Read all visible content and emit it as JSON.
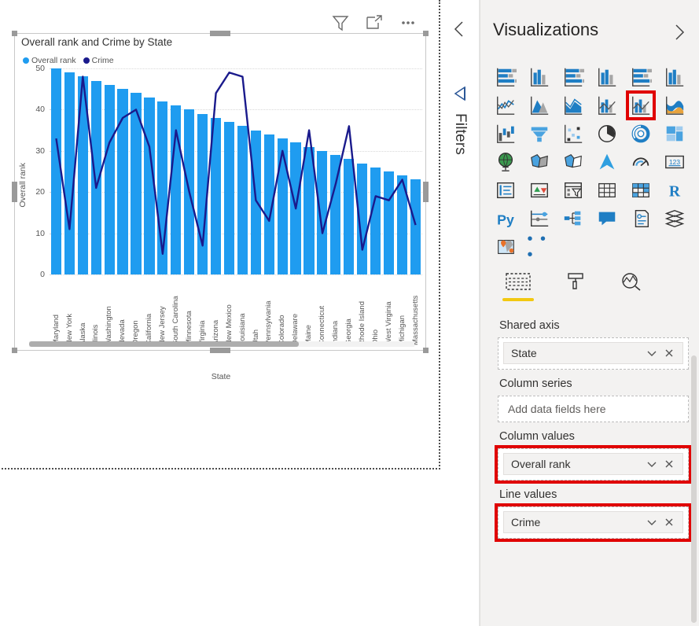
{
  "canvas": {
    "toolbar": [
      {
        "name": "filter-icon",
        "label": "Filters"
      },
      {
        "name": "focus-mode-icon",
        "label": "Focus mode"
      },
      {
        "name": "more-options-icon",
        "label": "More options"
      }
    ]
  },
  "visual": {
    "title": "Overall rank and Crime by State",
    "legend": [
      {
        "label": "Overall rank",
        "color": "#1f9cf0"
      },
      {
        "label": "Crime",
        "color": "#1a1a8c"
      }
    ],
    "x_axis_title": "State",
    "y_axis_title": "Overall rank",
    "y_ticks": [
      "0",
      "10",
      "20",
      "30",
      "40",
      "50"
    ]
  },
  "chart_data": {
    "type": "bar",
    "title": "Overall rank and Crime by State",
    "xlabel": "State",
    "ylabel": "Overall rank",
    "ylim": [
      0,
      50
    ],
    "grid": true,
    "legend_position": "top-left",
    "categories": [
      "Maryland",
      "New York",
      "Alaska",
      "Illinois",
      "Washington",
      "Nevada",
      "Oregon",
      "California",
      "New Jersey",
      "South Carolina",
      "Minnesota",
      "Virginia",
      "Arizona",
      "New Mexico",
      "Louisiana",
      "Utah",
      "Pennsylvania",
      "Colorado",
      "Delaware",
      "Maine",
      "Connecticut",
      "Indiana",
      "Georgia",
      "Rhode Island",
      "Ohio",
      "West Virginia",
      "Michigan",
      "Massachusetts"
    ],
    "series": [
      {
        "name": "Overall rank",
        "type": "column",
        "color": "#1f9cf0",
        "values": [
          50,
          49,
          48,
          47,
          46,
          45,
          44,
          43,
          42,
          41,
          40,
          39,
          38,
          37,
          36,
          35,
          34,
          33,
          32,
          31,
          30,
          29,
          28,
          27,
          26,
          25,
          24,
          23
        ]
      },
      {
        "name": "Crime",
        "type": "line",
        "color": "#1a1a8c",
        "values": [
          33,
          11,
          48,
          21,
          32,
          38,
          40,
          31,
          5,
          35,
          20,
          7,
          44,
          49,
          48,
          18,
          13,
          30,
          16,
          35,
          10,
          22,
          36,
          6,
          19,
          18,
          23,
          12
        ]
      }
    ]
  },
  "filters_pane": {
    "label": "Filters",
    "collapse_icon": "chevron-left-icon",
    "expand_icon": "filter-expand-icon"
  },
  "visualizations": {
    "title": "Visualizations",
    "expand_icon": "chevron-right-icon",
    "icons": [
      "stacked-bar-chart-icon",
      "stacked-column-chart-icon",
      "clustered-bar-chart-icon",
      "clustered-column-chart-icon",
      "100-stacked-bar-chart-icon",
      "100-stacked-column-chart-icon",
      "line-chart-icon",
      "area-chart-icon",
      "stacked-area-chart-icon",
      "line-and-stacked-column-chart-icon",
      "line-and-clustered-column-chart-icon",
      "ribbon-chart-icon",
      "waterfall-chart-icon",
      "funnel-chart-icon",
      "scatter-chart-icon",
      "pie-chart-icon",
      "donut-chart-icon",
      "treemap-icon",
      "map-icon",
      "filled-map-icon",
      "shape-map-icon",
      "arcgis-map-icon",
      "gauge-icon",
      "card-icon",
      "multi-row-card-icon",
      "kpi-icon",
      "slicer-icon",
      "table-icon",
      "matrix-icon",
      "r-script-visual-icon",
      "python-visual-icon",
      "key-influencers-icon",
      "decomposition-tree-icon",
      "q-and-a-icon",
      "smart-narrative-icon",
      "paginated-report-icon",
      "power-apps-icon"
    ],
    "selected_icon": "line-and-clustered-column-chart-icon",
    "more_icons_label": "• • •",
    "tabs": [
      {
        "name": "fields-tab",
        "icon": "fields-icon",
        "active": true
      },
      {
        "name": "format-tab",
        "icon": "paint-roller-icon",
        "active": false
      },
      {
        "name": "analytics-tab",
        "icon": "analytics-magnifier-icon",
        "active": false
      }
    ],
    "wells": [
      {
        "label": "Shared axis",
        "field": "State",
        "highlighted": false,
        "placeholder": null
      },
      {
        "label": "Column series",
        "field": null,
        "highlighted": false,
        "placeholder": "Add data fields here"
      },
      {
        "label": "Column values",
        "field": "Overall rank",
        "highlighted": true,
        "placeholder": null
      },
      {
        "label": "Line values",
        "field": "Crime",
        "highlighted": true,
        "placeholder": null
      }
    ],
    "chip_buttons": [
      "chevron-down-icon",
      "remove-field-icon"
    ]
  }
}
